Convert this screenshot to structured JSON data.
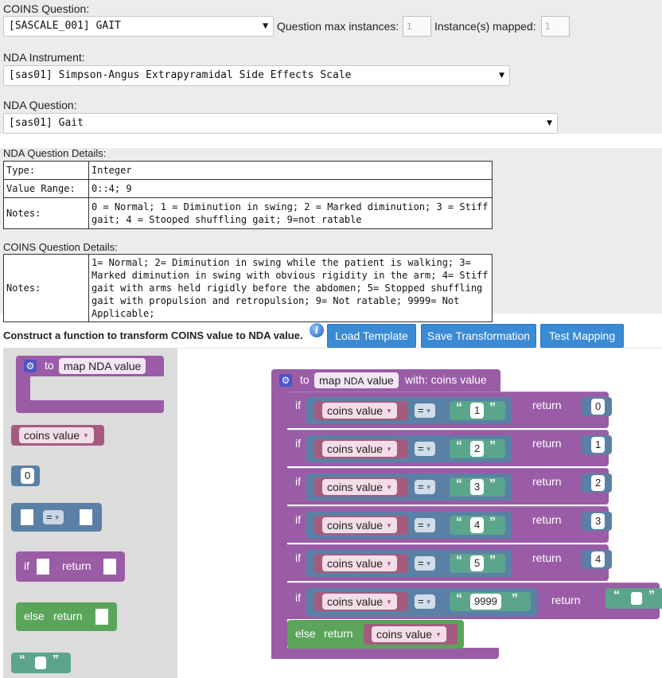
{
  "coins_question": {
    "label": "COINS Question:",
    "selected": "[SASCALE_001] GAIT",
    "max_instances_label": "Question max instances:",
    "max_instances_value": "1",
    "mapped_label": "Instance(s) mapped:",
    "mapped_value": "1"
  },
  "nda_instrument": {
    "label": "NDA Instrument:",
    "selected": "[sas01] Simpson-Angus Extrapyramidal Side Effects Scale"
  },
  "nda_question": {
    "label": "NDA Question:",
    "selected": "[sas01] Gait"
  },
  "nda_details": {
    "label": "NDA Question Details:",
    "rows": [
      {
        "key": "Type:",
        "value": "Integer"
      },
      {
        "key": "Value Range:",
        "value": "0::4; 9"
      },
      {
        "key": "Notes:",
        "value": "0 = Normal; 1 = Diminution in swing; 2 = Marked diminution; 3 = Stiff gait; 4 = Stooped shuffling gait; 9=not ratable"
      }
    ]
  },
  "coins_details": {
    "label": "COINS Question Details:",
    "notes_key": "Notes:",
    "notes_value": "1= Normal; 2= Diminution in swing while the patient is walking; 3= Marked diminution in swing with obvious rigidity in the arm; 4= Stiff gait with arms held rigidly before the abdomen; 5= Stopped shuffling gait with propulsion and retropulsion; 9= Not ratable; 9999= Not Applicable;"
  },
  "construct": {
    "text": "Construct a function to transform COINS value to NDA value.",
    "buttons": {
      "load": "Load Template",
      "save": "Save Transformation",
      "test": "Test Mapping"
    }
  },
  "toolbox": {
    "func_to": "to",
    "func_name": "map NDA value",
    "var_name": "coins value",
    "number": "0",
    "equals_op": "=",
    "if_kw": "if",
    "return_kw": "return",
    "else_kw": "else"
  },
  "workspace": {
    "to": "to",
    "func_name_a": "map",
    "func_name_b": "NDA",
    "func_name_c": "value",
    "with": "with: coins value",
    "if_kw": "if",
    "return_kw": "return",
    "else_kw": "else",
    "var_name": "coins value",
    "op": "=",
    "rules": [
      {
        "match": "1",
        "ret": "0"
      },
      {
        "match": "2",
        "ret": "1"
      },
      {
        "match": "3",
        "ret": "2"
      },
      {
        "match": "4",
        "ret": "3"
      },
      {
        "match": "5",
        "ret": "4"
      },
      {
        "match": "9999",
        "ret": ""
      }
    ],
    "else_return": "coins value"
  },
  "colors": {
    "procedure": "#9a5ca6",
    "logic": "#5b80a5",
    "variable": "#a55b80",
    "text": "#5ba58c",
    "control": "#5ba55b",
    "button": "#3a8ad4"
  }
}
